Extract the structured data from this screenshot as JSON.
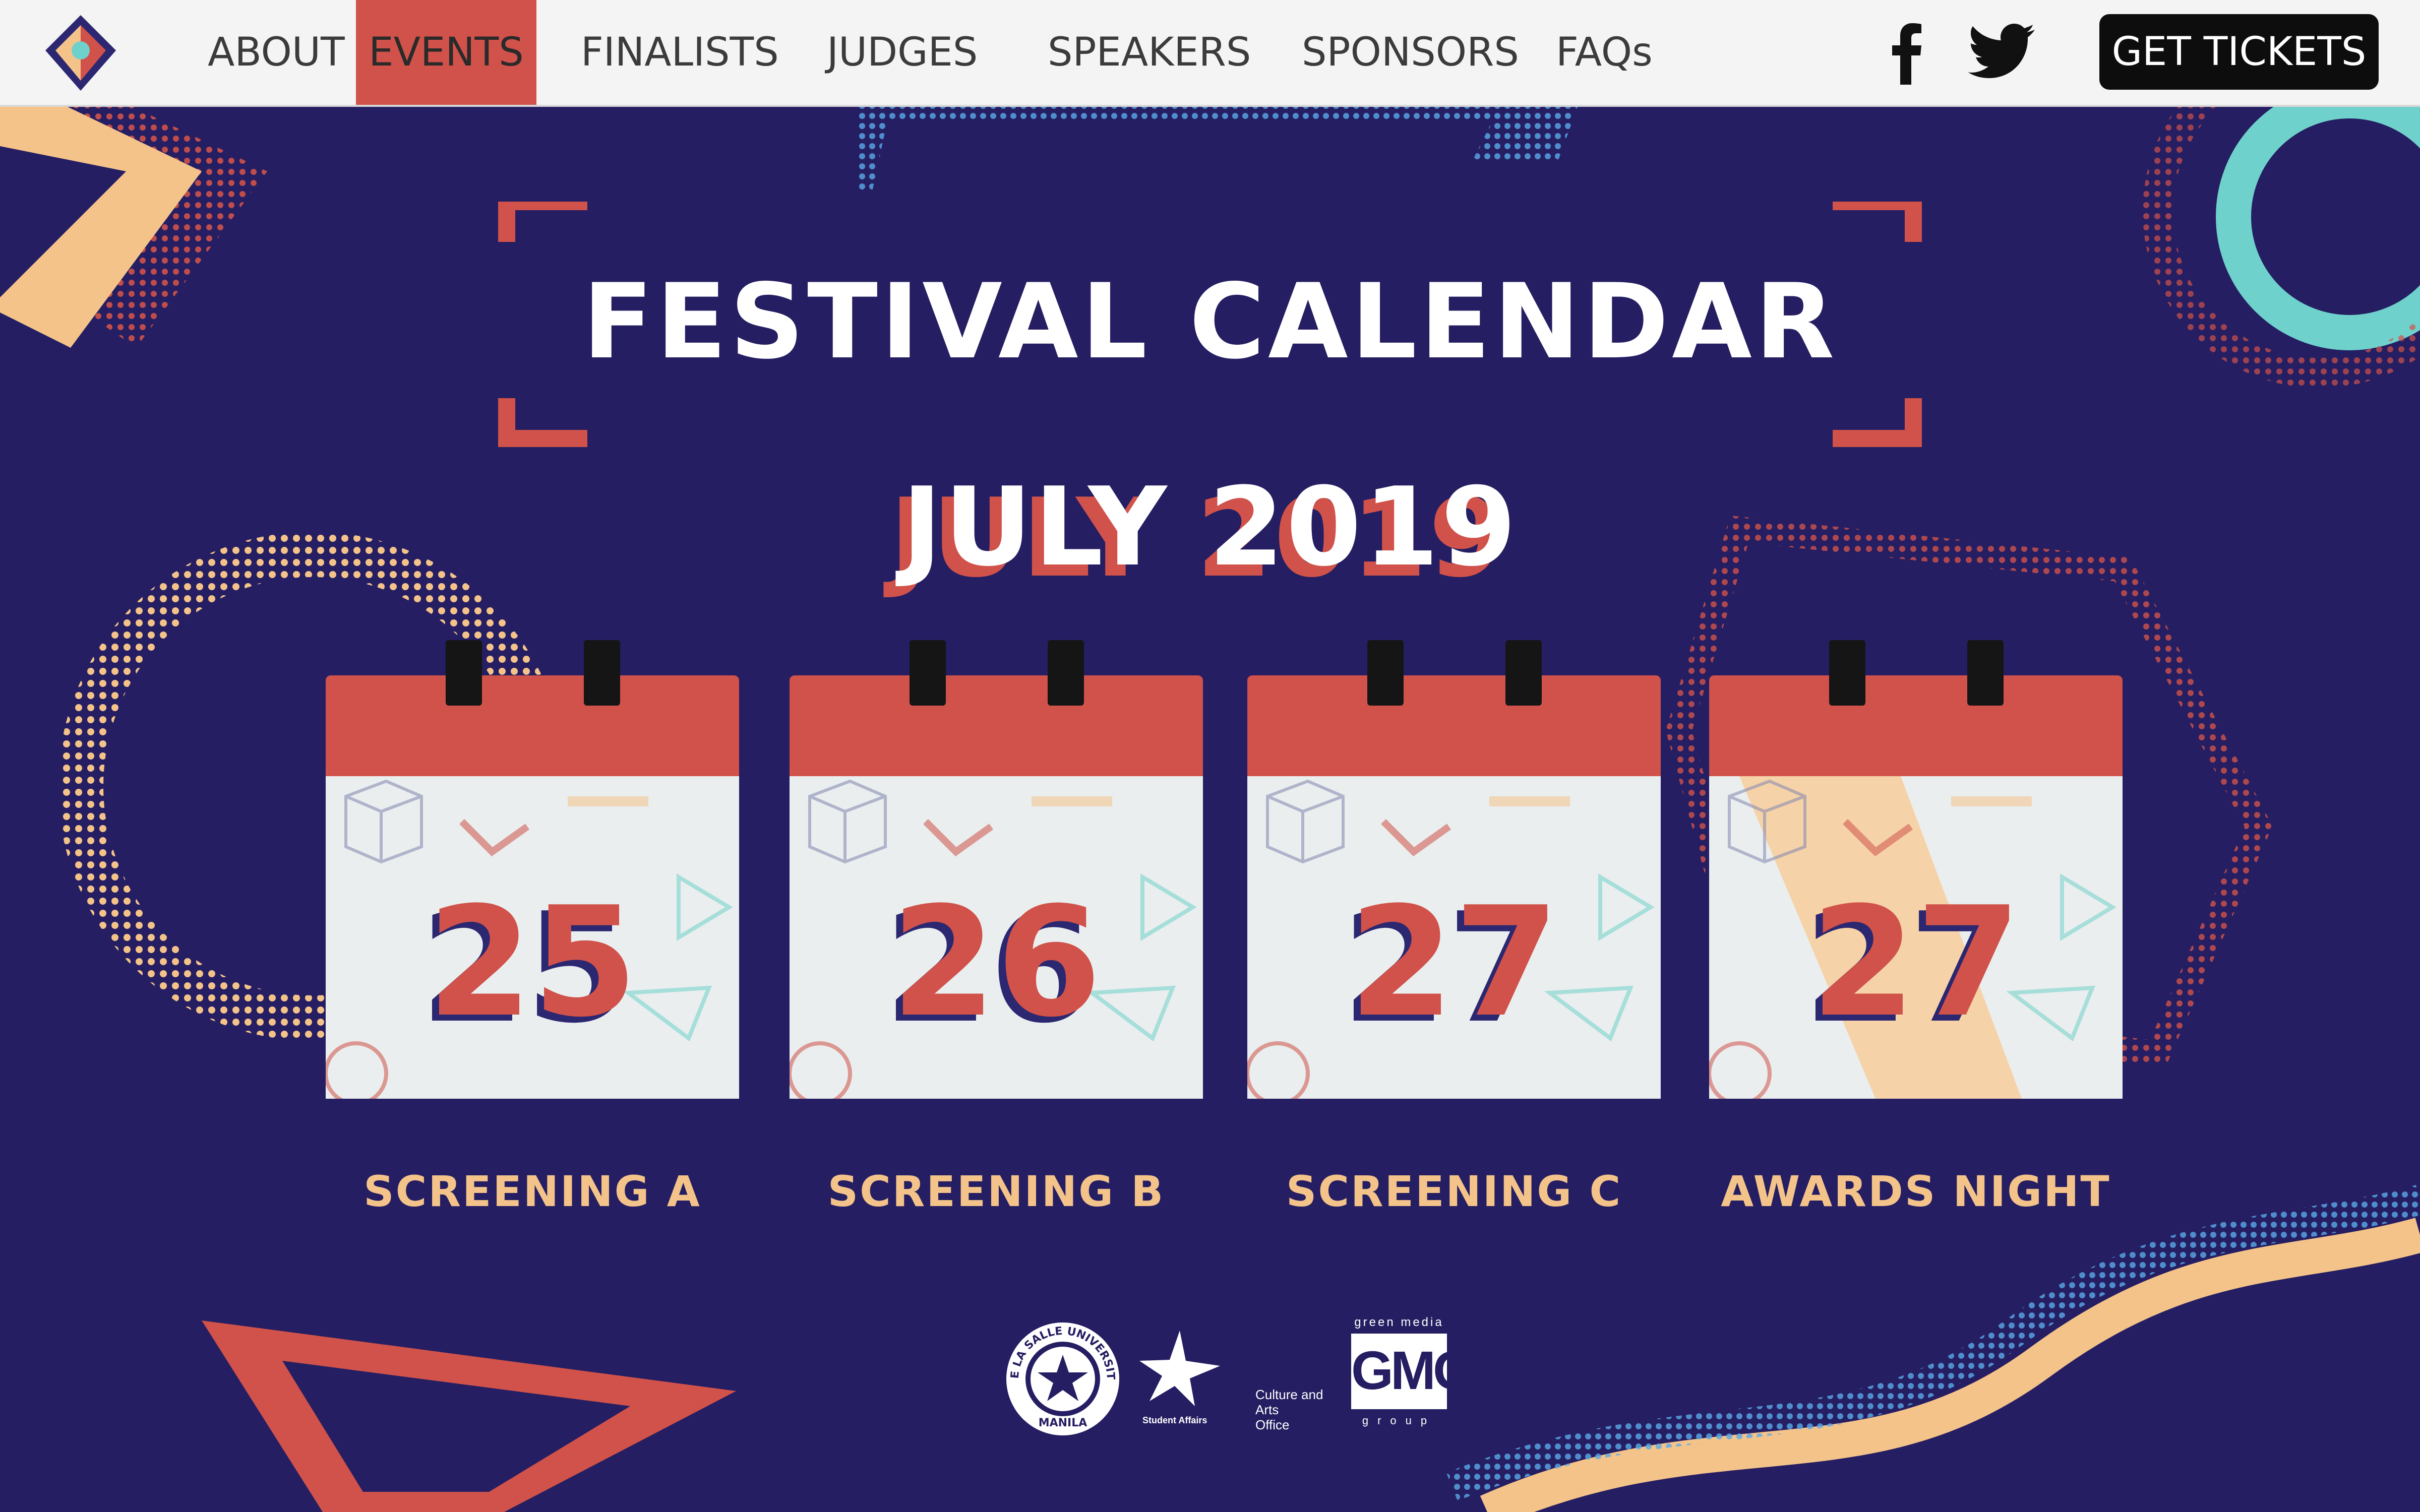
{
  "nav": {
    "items": [
      "ABOUT",
      "EVENTS",
      "FINALISTS",
      "JUDGES",
      "SPEAKERS",
      "SPONSORS",
      "FAQs"
    ],
    "active": "EVENTS",
    "tickets_label": "GET TICKETS",
    "social_icons": [
      "facebook-icon",
      "twitter-icon"
    ]
  },
  "main": {
    "title": "FESTIVAL CALENDAR",
    "month": "JULY 2019",
    "days": [
      {
        "date": "25",
        "event": "SCREENING A"
      },
      {
        "date": "26",
        "event": "SCREENING B"
      },
      {
        "date": "27",
        "event": "SCREENING C"
      },
      {
        "date": "27",
        "event": "AWARDS NIGHT"
      }
    ]
  },
  "footer": {
    "logos": [
      {
        "name": "dlsu-seal",
        "text": "DE LA SALLE UNIVERSITY",
        "subtext": "MANILA"
      },
      {
        "name": "student-affairs-logo",
        "text": "Student Affairs"
      },
      {
        "name": "culture-arts-office-logo",
        "lines": [
          "Culture and",
          "Arts",
          "Office"
        ]
      },
      {
        "name": "gmg-logo",
        "top": "green media",
        "mark": "GMG",
        "bottom": "group"
      }
    ]
  },
  "colors": {
    "background": "#251e62",
    "accent_red": "#d0524a",
    "peach": "#f4c38a",
    "teal": "#6fd1cb",
    "nav_bg": "#f4f4f4"
  }
}
